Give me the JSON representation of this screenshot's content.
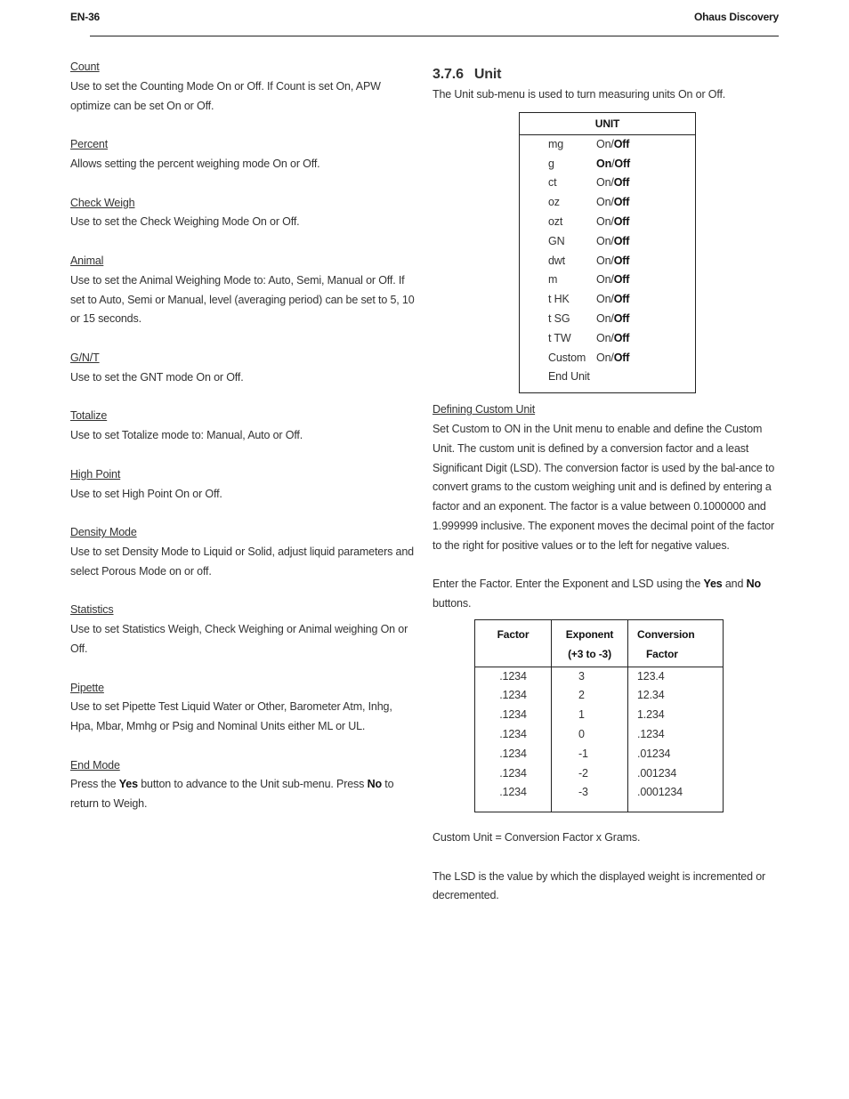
{
  "header": {
    "page_number": "EN-36",
    "doc_title": "Ohaus Discovery"
  },
  "left_column": {
    "sections": [
      {
        "title": "Count ",
        "body": "Use to set  the Counting Mode On or Off.  If Count is set On, APW optimize can be set On or Off."
      },
      {
        "title": "Percent ",
        "body": "Allows setting the percent weighing mode On or Off."
      },
      {
        "title": "Check Weigh ",
        "body": "Use to set the Check Weighing Mode On or Off."
      },
      {
        "title": "Animal ",
        "body": "Use to set the Animal Weighing Mode to: Auto, Semi, Manual or Off. If set to Auto, Semi or Manual, level (averaging period) can be set to 5, 10 or 15 seconds."
      },
      {
        "title": "G/N/T",
        "body": "Use to set the GNT mode On or Off."
      },
      {
        "title": "Totalize",
        "body": "Use to set Totalize mode to: Manual, Auto or Off."
      },
      {
        "title": "High Point",
        "body": "Use to set High Point On or Off."
      },
      {
        "title": "Density Mode",
        "body": "Use to set Density Mode to Liquid or Solid, adjust liquid parameters and select Porous Mode on or off."
      },
      {
        "title": "Statistics",
        "body": "Use to set Statistics Weigh, Check Weighing or Animal weighing On or Off."
      },
      {
        "title": "Pipette",
        "body": "Use to set Pipette Test Liquid Water or Other, Barometer Atm, Inhg, Hpa, Mbar, Mmhg or Psig and Nominal Units either ML or UL."
      }
    ],
    "end_mode": {
      "title": "End Mode",
      "part1": "Press the ",
      "yes": "Yes",
      "part2": " button to advance to the Unit sub-menu.  Press ",
      "no": "No",
      "part3": " to return to Weigh."
    }
  },
  "right_column": {
    "section_number": "3.7.6",
    "section_title": "Unit",
    "intro": "The Unit sub-menu is used to turn measuring units On or Off.",
    "unit_table": {
      "title": "UNIT",
      "rows": [
        {
          "unit": "mg",
          "on": "On",
          "sep": "/",
          "off": "Off",
          "selected": "Off"
        },
        {
          "unit": "g",
          "on": "On",
          "sep": "/",
          "off": "Off",
          "selected": "Both"
        },
        {
          "unit": "ct",
          "on": "On",
          "sep": "/",
          "off": "Off",
          "selected": "Off"
        },
        {
          "unit": "oz",
          "on": "On",
          "sep": "/",
          "off": "Off",
          "selected": "Off"
        },
        {
          "unit": "ozt",
          "on": "On",
          "sep": "/",
          "off": "Off",
          "selected": "Off"
        },
        {
          "unit": "GN",
          "on": "On",
          "sep": "/",
          "off": "Off",
          "selected": "Off"
        },
        {
          "unit": "dwt",
          "on": "On",
          "sep": "/",
          "off": "Off",
          "selected": "Off"
        },
        {
          "unit": "m",
          "on": "On",
          "sep": "/",
          "off": "Off",
          "selected": "Off"
        },
        {
          "unit": "t HK",
          "on": "On",
          "sep": "/",
          "off": "Off",
          "selected": "Off"
        },
        {
          "unit": "t SG",
          "on": "On",
          "sep": "/",
          "off": "Off",
          "selected": "Off"
        },
        {
          "unit": "t TW",
          "on": "On",
          "sep": "/",
          "off": "Off",
          "selected": "Off"
        },
        {
          "unit": "Custom",
          "on": "On",
          "sep": "/",
          "off": "Off",
          "selected": "Off"
        }
      ],
      "end_label": "End Unit"
    },
    "custom_unit": {
      "title": "Defining Custom Unit",
      "body": "Set Custom to ON in the Unit menu to enable and define the Custom Unit.  The custom unit is defined by a conversion factor and a least Significant Digit (LSD).  The conversion factor is used by the bal-ance to convert grams to the custom weighing unit and is defined by entering a factor and an exponent.  The factor is a value between 0.1000000 and 1.999999 inclusive.  The exponent moves the decimal point of the factor to the right for positive values or to the left for negative values."
    },
    "enter_factor": {
      "part1": "Enter the Factor.  Enter the Exponent and LSD using the ",
      "yes": "Yes",
      "part2": " and ",
      "no": "No",
      "part3": " buttons."
    },
    "factor_table": {
      "headers": {
        "factor": "Factor",
        "exponent_line1": "Exponent",
        "exponent_line2": "(+3 to -3)",
        "conversion_line1": "Conversion",
        "conversion_line2": "Factor"
      },
      "rows": [
        {
          "factor": ".1234",
          "exponent": "3",
          "conversion": "123.4"
        },
        {
          "factor": ".1234",
          "exponent": "2",
          "conversion": "12.34"
        },
        {
          "factor": ".1234",
          "exponent": "1",
          "conversion": "1.234"
        },
        {
          "factor": ".1234",
          "exponent": "0",
          "conversion": ".1234"
        },
        {
          "factor": ".1234",
          "exponent": "-1",
          "conversion": ".01234"
        },
        {
          "factor": ".1234",
          "exponent": "-2",
          "conversion": ".001234"
        },
        {
          "factor": ".1234",
          "exponent": "-3",
          "conversion": ".0001234"
        }
      ]
    },
    "formula": "Custom Unit = Conversion Factor x Grams.",
    "lsd_note": "The LSD is the value by which the displayed weight is incremented or decremented."
  }
}
